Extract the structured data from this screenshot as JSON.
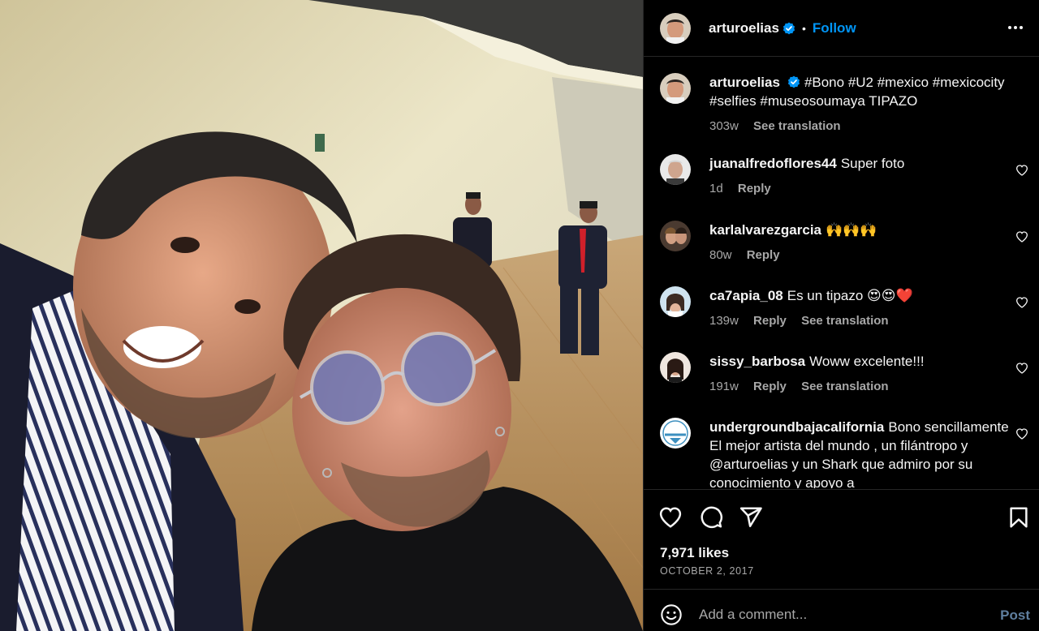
{
  "post": {
    "username": "arturoelias",
    "separator": "•",
    "follow_label": "Follow",
    "caption_text": "#Bono #U2 #mexico #mexicocity #selfies #museosoumaya TIPAZO",
    "caption_time": "303w",
    "caption_see_translation": "See translation"
  },
  "comments": [
    {
      "username": "juanalfredoflores44",
      "text": "Super foto",
      "time": "1d",
      "reply": "Reply",
      "see_translation": ""
    },
    {
      "username": "karlalvarezgarcia",
      "text": "🙌🙌🙌",
      "time": "80w",
      "reply": "Reply",
      "see_translation": ""
    },
    {
      "username": "ca7apia_08",
      "text": "Es un tipazo 😍😍❤️",
      "time": "139w",
      "reply": "Reply",
      "see_translation": "See translation"
    },
    {
      "username": "sissy_barbosa",
      "text": "Woww excelente!!!",
      "time": "191w",
      "reply": "Reply",
      "see_translation": "See translation"
    },
    {
      "username": "undergroundbajacalifornia",
      "text": "Bono sencillamente El mejor artista del mundo , un filántropo y @arturoelias y un Shark que admiro por su conocimiento y apoyo a",
      "time": "",
      "reply": "",
      "see_translation": ""
    }
  ],
  "stats": {
    "likes": "7,971 likes",
    "date": "OCTOBER 2, 2017"
  },
  "composer": {
    "placeholder": "Add a comment...",
    "post_label": "Post"
  },
  "icons": {
    "more": "more-options-icon",
    "verified": "verified-badge-icon",
    "like": "heart-icon",
    "comment": "comment-bubble-icon",
    "share": "paper-plane-icon",
    "save": "bookmark-icon",
    "emoji": "emoji-icon",
    "comment_like": "heart-outline-icon"
  },
  "colors": {
    "background": "#000000",
    "text": "#f5f5f5",
    "secondary_text": "#a8a8a8",
    "link_blue": "#0095f6",
    "divider": "#262626"
  }
}
